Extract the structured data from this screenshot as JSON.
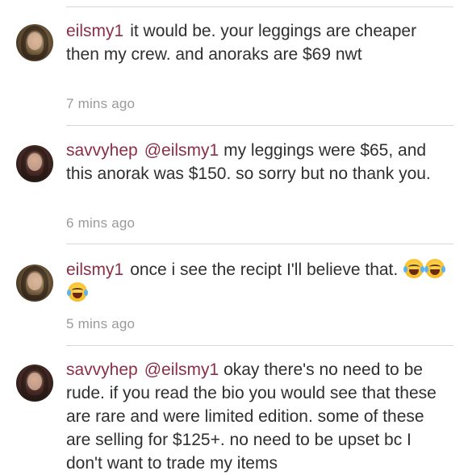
{
  "comments": [
    {
      "username": "eilsmy1",
      "mention": "",
      "body": "it would be. your leggings are cheaper then my crew. and anoraks are $69 nwt",
      "time": "7 mins ago"
    },
    {
      "username": "savvyhep",
      "mention": "@eilsmy1",
      "body": "my leggings were $65, and this anorak was $150. so sorry but no thank you.",
      "time": "6 mins ago"
    },
    {
      "username": "eilsmy1",
      "mention": "",
      "body": "once i see the recipt I'll believe that.",
      "emoji": "face-with-tears-of-joy-icon x3",
      "time": "5 mins ago"
    },
    {
      "username": "savvyhep",
      "mention": "@eilsmy1",
      "body": "okay there's no need to be rude. if you read the bio you would see that these are rare and were limited edition. some of these are selling for $125+. no need to be upset bc I don't want to trade my items",
      "time": ""
    }
  ],
  "colors": {
    "username": "#8a2f45",
    "body": "#2f2f2f",
    "time": "#9a9a9a",
    "divider": "#d7d7d7"
  }
}
